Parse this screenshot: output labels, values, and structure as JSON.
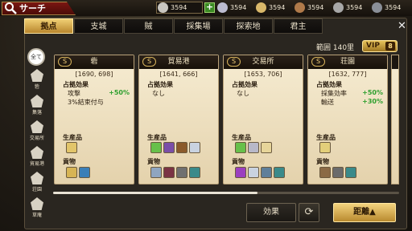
{
  "header": {
    "title": "サーチ",
    "resources": [
      {
        "icon": "silver-coin-icon",
        "value": "3594",
        "color": "#c9c6c0"
      },
      {
        "icon": "crystal-icon",
        "value": "3594",
        "color": "#bcbcd0"
      },
      {
        "icon": "grain-icon",
        "value": "3594",
        "color": "#d9b86a"
      },
      {
        "icon": "wood-icon",
        "value": "3594",
        "color": "#b07a4a"
      },
      {
        "icon": "stone-icon",
        "value": "3594",
        "color": "#a8a8a8"
      },
      {
        "icon": "iron-icon",
        "value": "3594",
        "color": "#8a8f98"
      }
    ]
  },
  "tabs": [
    "拠点",
    "支城",
    "賊",
    "採集場",
    "探索地",
    "君主"
  ],
  "active_tab": "拠点",
  "range_label": "範囲 140里",
  "vip": {
    "label": "VIP",
    "level": "8"
  },
  "sidebar": {
    "all_label": "全て",
    "items": [
      "砦",
      "集落",
      "交易所",
      "貿易港",
      "荘園",
      "草庵"
    ]
  },
  "cards": [
    {
      "rank": "S",
      "name": "砦",
      "coord": "[1690, 698]",
      "effect_label": "占拠効果",
      "effects": [
        {
          "name": "攻撃",
          "value": "+50%"
        },
        {
          "name": "3%結束付与",
          "value": ""
        }
      ],
      "products_label": "生産品",
      "goods_label": "貢物",
      "products": [
        "#e2c56a"
      ],
      "goods": [
        "#d7b454",
        "#3b7fb7"
      ]
    },
    {
      "rank": "S",
      "name": "貿易港",
      "coord": "[1641, 666]",
      "effect_label": "占拠効果",
      "effects": [
        {
          "name": "なし",
          "value": ""
        }
      ],
      "products_label": "生産品",
      "goods_label": "貢物",
      "products": [
        "#67c04a",
        "#7a4fa8",
        "#8b5a2b",
        "#c9d2e0"
      ],
      "goods": [
        "#8fa5c0",
        "#7a3344",
        "#707070",
        "#3a8a8a"
      ]
    },
    {
      "rank": "S",
      "name": "交易所",
      "coord": "[1653, 706]",
      "effect_label": "占拠効果",
      "effects": [
        {
          "name": "なし",
          "value": ""
        }
      ],
      "products_label": "生産品",
      "goods_label": "貢物",
      "products": [
        "#67c04a",
        "#b8b8c8",
        "#e7d59a"
      ],
      "goods": [
        "#9b3fbf",
        "#c9d2e0",
        "#5f7f9a",
        "#3a8a8a"
      ]
    },
    {
      "rank": "S",
      "name": "荘園",
      "coord": "[1632, 777]",
      "effect_label": "占拠効果",
      "effects": [
        {
          "name": "採集効率",
          "value": "+50%"
        },
        {
          "name": "輸送",
          "value": "+30%"
        }
      ],
      "products_label": "生産品",
      "goods_label": "貢物",
      "products": [
        "#e3cf7a"
      ],
      "goods": [
        "#8b6a45",
        "#6b6b6b",
        "#3a8a8a"
      ]
    }
  ],
  "buttons": {
    "effect": "効果",
    "refresh": "⟳",
    "distance": "距離▲"
  },
  "close": "✕"
}
